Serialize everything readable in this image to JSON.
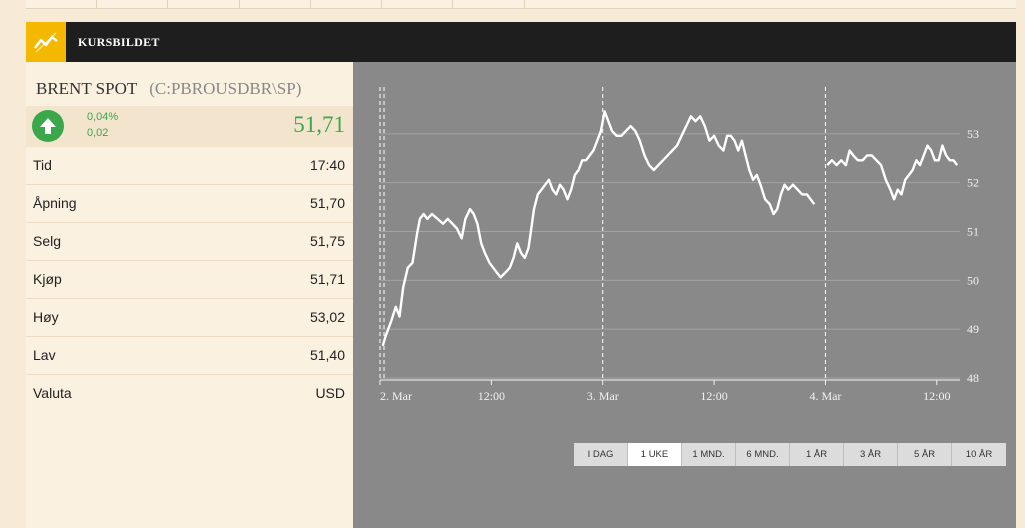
{
  "header": {
    "title": "KURSBILDET",
    "icon": "chart-line-icon"
  },
  "instrument": {
    "name": "BRENT SPOT",
    "ticker": "(C:PBROUSDBR\\SP)"
  },
  "change": {
    "percent": "0,04%",
    "absolute": "0,02",
    "price": "51,71",
    "direction": "up",
    "color": "#3aa84a"
  },
  "stats": [
    {
      "label": "Tid",
      "value": "17:40"
    },
    {
      "label": "Åpning",
      "value": "51,70"
    },
    {
      "label": "Selg",
      "value": "51,75"
    },
    {
      "label": "Kjøp",
      "value": "51,71"
    },
    {
      "label": "Høy",
      "value": "53,02"
    },
    {
      "label": "Lav",
      "value": "51,40"
    },
    {
      "label": "Valuta",
      "value": "USD"
    }
  ],
  "ranges": [
    {
      "label": "I DAG",
      "active": false
    },
    {
      "label": "1 UKE",
      "active": true
    },
    {
      "label": "1 MND.",
      "active": false
    },
    {
      "label": "6 MND.",
      "active": false
    },
    {
      "label": "1 ÅR",
      "active": false
    },
    {
      "label": "3 ÅR",
      "active": false
    },
    {
      "label": "5 ÅR",
      "active": false
    },
    {
      "label": "10 ÅR",
      "active": false
    }
  ],
  "chart_data": {
    "type": "line",
    "ylim": [
      48,
      54
    ],
    "yticks": [
      "53",
      "52",
      "51",
      "50",
      "49",
      "48"
    ],
    "ytick_values": [
      53,
      52,
      51,
      50,
      49,
      48
    ],
    "xlim": [
      0,
      62.5
    ],
    "xticks": [
      {
        "label": "2. Mar",
        "x": 0
      },
      {
        "label": "12:00",
        "x": 12
      },
      {
        "label": "3. Mar",
        "x": 24
      },
      {
        "label": "12:00",
        "x": 36
      },
      {
        "label": "4. Mar",
        "x": 48
      },
      {
        "label": "12:00",
        "x": 60
      }
    ],
    "day_breaks": [
      0,
      24,
      48
    ],
    "grid": true,
    "series": [
      {
        "segments": [
          [
            [
              0.3,
              48.7
            ],
            [
              0.6,
              48.9
            ],
            [
              1.2,
              49.2
            ],
            [
              1.7,
              49.5
            ],
            [
              2.1,
              49.3
            ],
            [
              2.5,
              49.9
            ],
            [
              3,
              50.3
            ],
            [
              3.5,
              50.4
            ],
            [
              4,
              51
            ],
            [
              4.3,
              51.3
            ],
            [
              4.7,
              51.4
            ],
            [
              5.1,
              51.3
            ],
            [
              5.6,
              51.4
            ],
            [
              6.2,
              51.3
            ],
            [
              6.8,
              51.2
            ],
            [
              7.3,
              51.3
            ],
            [
              7.8,
              51.2
            ],
            [
              8.3,
              51.1
            ],
            [
              8.8,
              50.9
            ],
            [
              9.2,
              51.3
            ],
            [
              9.7,
              51.5
            ],
            [
              10.1,
              51.4
            ],
            [
              10.5,
              51.2
            ],
            [
              10.9,
              50.8
            ],
            [
              11.3,
              50.6
            ],
            [
              11.8,
              50.4
            ],
            [
              12.2,
              50.3
            ],
            [
              12.6,
              50.2
            ],
            [
              13,
              50.1
            ],
            [
              13.5,
              50.2
            ],
            [
              14,
              50.3
            ],
            [
              14.4,
              50.5
            ],
            [
              14.8,
              50.8
            ],
            [
              15.2,
              50.6
            ],
            [
              15.6,
              50.5
            ],
            [
              16,
              50.7
            ],
            [
              16.3,
              51.1
            ],
            [
              16.6,
              51.5
            ],
            [
              17,
              51.8
            ],
            [
              17.4,
              51.9
            ],
            [
              17.8,
              52
            ],
            [
              18.2,
              52.1
            ],
            [
              18.6,
              51.9
            ],
            [
              19,
              51.8
            ],
            [
              19.4,
              52
            ],
            [
              19.8,
              51.9
            ],
            [
              20.2,
              51.7
            ],
            [
              20.6,
              51.9
            ],
            [
              21,
              52.2
            ],
            [
              21.4,
              52.3
            ],
            [
              21.8,
              52.5
            ],
            [
              22.2,
              52.5
            ],
            [
              22.6,
              52.6
            ],
            [
              23,
              52.7
            ],
            [
              23.4,
              52.9
            ],
            [
              23.8,
              53.1
            ],
            [
              24.2,
              53.5
            ],
            [
              24.6,
              53.3
            ],
            [
              25,
              53.1
            ],
            [
              25.5,
              53
            ],
            [
              26,
              53
            ],
            [
              26.5,
              53.1
            ],
            [
              27,
              53.2
            ],
            [
              27.5,
              53.1
            ],
            [
              28,
              52.9
            ],
            [
              28.5,
              52.6
            ],
            [
              29,
              52.4
            ],
            [
              29.5,
              52.3
            ],
            [
              30,
              52.4
            ],
            [
              30.5,
              52.5
            ],
            [
              31,
              52.6
            ],
            [
              31.5,
              52.7
            ],
            [
              32,
              52.8
            ],
            [
              32.5,
              53
            ],
            [
              33,
              53.2
            ],
            [
              33.5,
              53.4
            ],
            [
              34,
              53.3
            ],
            [
              34.5,
              53.4
            ],
            [
              35,
              53.2
            ],
            [
              35.5,
              52.9
            ],
            [
              36,
              53
            ],
            [
              36.5,
              52.8
            ],
            [
              37,
              52.7
            ],
            [
              37.4,
              53
            ],
            [
              37.8,
              53
            ],
            [
              38.2,
              52.9
            ],
            [
              38.6,
              52.7
            ],
            [
              39,
              52.9
            ],
            [
              39.4,
              52.6
            ],
            [
              39.8,
              52.3
            ],
            [
              40.2,
              52.1
            ],
            [
              40.6,
              52.2
            ],
            [
              41,
              52
            ],
            [
              41.5,
              51.7
            ],
            [
              42,
              51.6
            ],
            [
              42.4,
              51.4
            ],
            [
              42.8,
              51.5
            ],
            [
              43.2,
              51.8
            ],
            [
              43.6,
              52
            ],
            [
              44,
              51.9
            ],
            [
              44.5,
              52
            ],
            [
              45,
              51.9
            ],
            [
              45.5,
              51.8
            ],
            [
              46,
              51.8
            ],
            [
              46.4,
              51.7
            ],
            [
              46.8,
              51.6
            ]
          ]
        ],
        "segments2": [
          [
            [
              48.2,
              52.4
            ],
            [
              48.7,
              52.5
            ],
            [
              49.2,
              52.4
            ],
            [
              49.7,
              52.5
            ],
            [
              50.2,
              52.4
            ],
            [
              50.6,
              52.7
            ],
            [
              51,
              52.6
            ],
            [
              51.5,
              52.5
            ],
            [
              52,
              52.5
            ],
            [
              52.5,
              52.6
            ],
            [
              53,
              52.6
            ],
            [
              53.5,
              52.5
            ],
            [
              54,
              52.4
            ],
            [
              54.5,
              52.1
            ],
            [
              55,
              51.9
            ],
            [
              55.4,
              51.7
            ],
            [
              55.8,
              51.9
            ],
            [
              56.2,
              51.8
            ],
            [
              56.6,
              52.1
            ],
            [
              57,
              52.2
            ],
            [
              57.4,
              52.3
            ],
            [
              57.8,
              52.5
            ],
            [
              58.2,
              52.4
            ],
            [
              58.6,
              52.6
            ],
            [
              59,
              52.8
            ],
            [
              59.4,
              52.7
            ],
            [
              59.8,
              52.5
            ],
            [
              60.2,
              52.5
            ],
            [
              60.6,
              52.8
            ],
            [
              61,
              52.6
            ],
            [
              61.4,
              52.5
            ],
            [
              61.8,
              52.5
            ],
            [
              62.2,
              52.4
            ]
          ]
        ]
      }
    ]
  }
}
